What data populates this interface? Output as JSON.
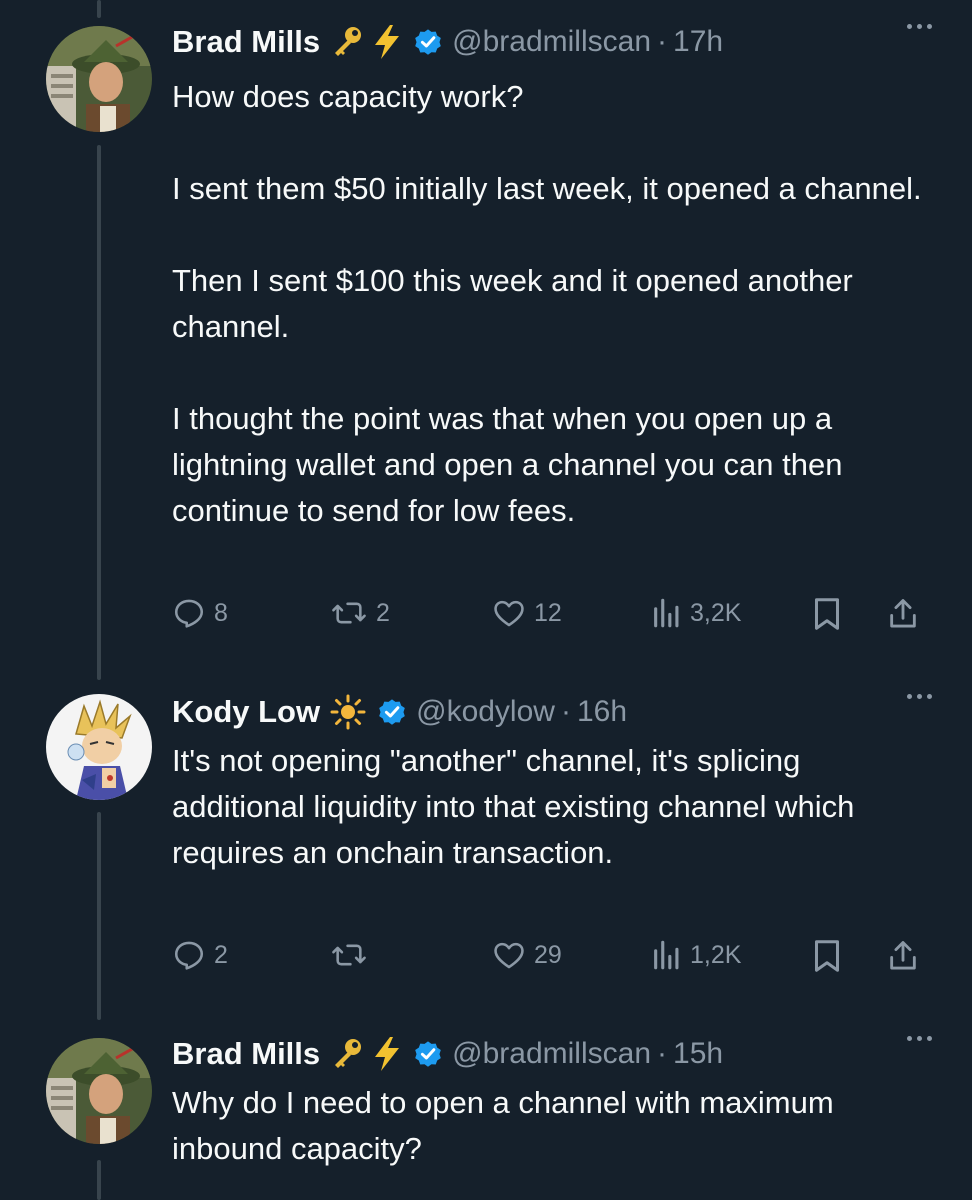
{
  "tweets": [
    {
      "name": "Brad Mills",
      "emoji": [
        "🔑",
        "⚡"
      ],
      "handle": "@bradmillscan",
      "time": "17h",
      "paragraphs": [
        "How does capacity work?",
        "",
        "I sent them $50 initially last week, it opened a channel.",
        "",
        "Then I sent $100 this week and it opened another channel.",
        "",
        "I thought the point was that when you open up a lightning wallet and open a channel you can then continue to send for low fees."
      ],
      "replies": "8",
      "retweets": "2",
      "likes": "12",
      "views": "3,2K"
    },
    {
      "name": "Kody Low",
      "emoji": [
        "☀"
      ],
      "handle": "@kodylow",
      "time": "16h",
      "paragraphs": [
        "It's not opening \"another\" channel, it's splicing additional liquidity into that existing channel which requires an onchain transaction."
      ],
      "replies": "2",
      "retweets": "",
      "likes": "29",
      "views": "1,2K"
    },
    {
      "name": "Brad Mills",
      "emoji": [
        "🔑",
        "⚡"
      ],
      "handle": "@bradmillscan",
      "time": "15h",
      "paragraphs": [
        "Why do I need to open a channel with maximum inbound capacity?"
      ]
    }
  ],
  "separator": "·",
  "colors": {
    "background": "#15202b",
    "text": "#f7f9f9",
    "secondary": "#8b98a5",
    "verified": "#1d9bf0",
    "thread_line": "#38444d",
    "key": "#e8b93a",
    "bolt": "#f2c230",
    "sun": "#f3b63c"
  }
}
